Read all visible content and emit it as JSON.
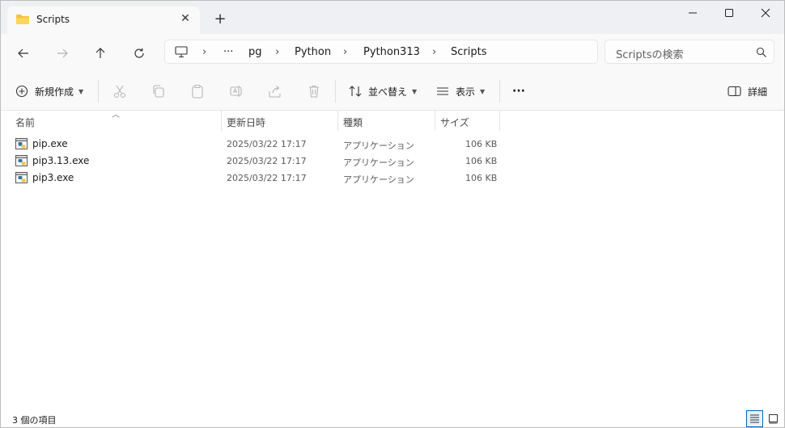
{
  "window": {
    "tab_title": "Scripts",
    "tab_close_glyph": "✕",
    "new_tab_glyph": "+"
  },
  "address": {
    "crumbs": [
      "pg",
      "Python",
      "Python313",
      "Scripts"
    ],
    "overflow": "···",
    "separator": "›"
  },
  "search": {
    "placeholder": "Scriptsの検索"
  },
  "commands": {
    "new": "新規作成",
    "sort": "並べ替え",
    "view": "表示",
    "more": "···",
    "details": "詳細"
  },
  "columns": [
    "名前",
    "更新日時",
    "種類",
    "サイズ"
  ],
  "files": [
    {
      "name": "pip.exe",
      "date": "2025/03/22 17:17",
      "type": "アプリケーション",
      "size": "106 KB"
    },
    {
      "name": "pip3.13.exe",
      "date": "2025/03/22 17:17",
      "type": "アプリケーション",
      "size": "106 KB"
    },
    {
      "name": "pip3.exe",
      "date": "2025/03/22 17:17",
      "type": "アプリケーション",
      "size": "106 KB"
    }
  ],
  "status": {
    "item_count": "3 個の項目"
  },
  "colors": {
    "accent": "#0067c0",
    "folder": "#f4c23d",
    "background": "#f9f9f9"
  }
}
